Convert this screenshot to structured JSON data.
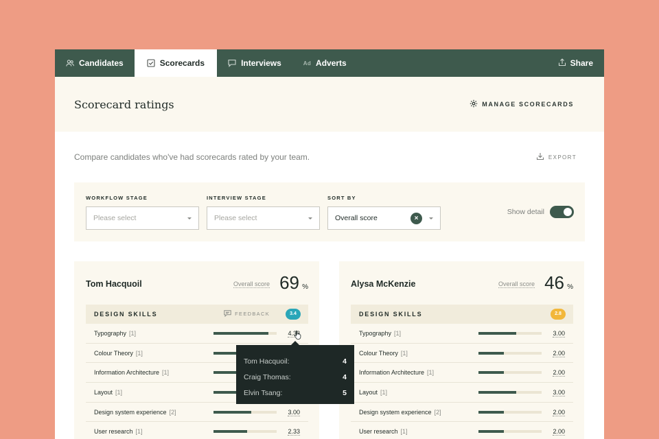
{
  "nav": {
    "tabs": [
      {
        "label": "Candidates",
        "icon": "users-icon"
      },
      {
        "label": "Scorecards",
        "icon": "checkbox-icon",
        "active": true
      },
      {
        "label": "Interviews",
        "icon": "chat-icon"
      },
      {
        "label": "Adverts",
        "icon": "ad-icon",
        "glyph": "Ad"
      }
    ],
    "share_label": "Share"
  },
  "header": {
    "title": "Scorecard ratings",
    "manage_label": "MANAGE SCORECARDS"
  },
  "subheader": {
    "text": "Compare candidates who've had scorecards rated by your team.",
    "export_label": "EXPORT"
  },
  "filters": {
    "workflow_stage": {
      "label": "WORKFLOW STAGE",
      "placeholder": "Please select"
    },
    "interview_stage": {
      "label": "INTERVIEW STAGE",
      "placeholder": "Please select"
    },
    "sort_by": {
      "label": "SORT BY",
      "value": "Overall score"
    },
    "show_detail": {
      "label": "Show detail",
      "on": true
    }
  },
  "candidates": [
    {
      "name": "Tom Hacquoil",
      "overall_label": "Overall score",
      "overall_score": "69",
      "pct": "%",
      "section": {
        "title": "DESIGN SKILLS",
        "feedback_label": "FEEDBACK",
        "badge": "3.4",
        "badge_color": "#2aa6b8",
        "skills": [
          {
            "name": "Typography",
            "weight": "[1]",
            "value": "4.33",
            "fill": 0.87
          },
          {
            "name": "Colour Theory",
            "weight": "[1]",
            "value": "",
            "fill": 0.6
          },
          {
            "name": "Information Architecture",
            "weight": "[1]",
            "value": "",
            "fill": 0.6
          },
          {
            "name": "Layout",
            "weight": "[1]",
            "value": "",
            "fill": 0.6
          },
          {
            "name": "Design system experience",
            "weight": "[2]",
            "value": "3.00",
            "fill": 0.6
          },
          {
            "name": "User research",
            "weight": "[1]",
            "value": "2.33",
            "fill": 0.53
          }
        ]
      }
    },
    {
      "name": "Alysa McKenzie",
      "overall_label": "Overall score",
      "overall_score": "46",
      "pct": "%",
      "section": {
        "title": "DESIGN SKILLS",
        "badge": "2.8",
        "badge_color": "#f2b73a",
        "skills": [
          {
            "name": "Typography",
            "weight": "[1]",
            "value": "3.00",
            "fill": 0.6
          },
          {
            "name": "Colour Theory",
            "weight": "[1]",
            "value": "2.00",
            "fill": 0.4
          },
          {
            "name": "Information Architecture",
            "weight": "[1]",
            "value": "2.00",
            "fill": 0.4
          },
          {
            "name": "Layout",
            "weight": "[1]",
            "value": "3.00",
            "fill": 0.6
          },
          {
            "name": "Design system experience",
            "weight": "[2]",
            "value": "2.00",
            "fill": 0.4
          },
          {
            "name": "User research",
            "weight": "[1]",
            "value": "2.00",
            "fill": 0.4
          }
        ]
      }
    }
  ],
  "tooltip": {
    "rows": [
      {
        "name": "Tom Hacquoil:",
        "value": "4"
      },
      {
        "name": "Craig Thomas:",
        "value": "4"
      },
      {
        "name": "Elvin Tsang:",
        "value": "5"
      }
    ]
  },
  "colors": {
    "nav": "#3e5a4d",
    "background": "#ee9c84",
    "panel": "#fbf8ef",
    "bar": "#3e5a4d"
  }
}
